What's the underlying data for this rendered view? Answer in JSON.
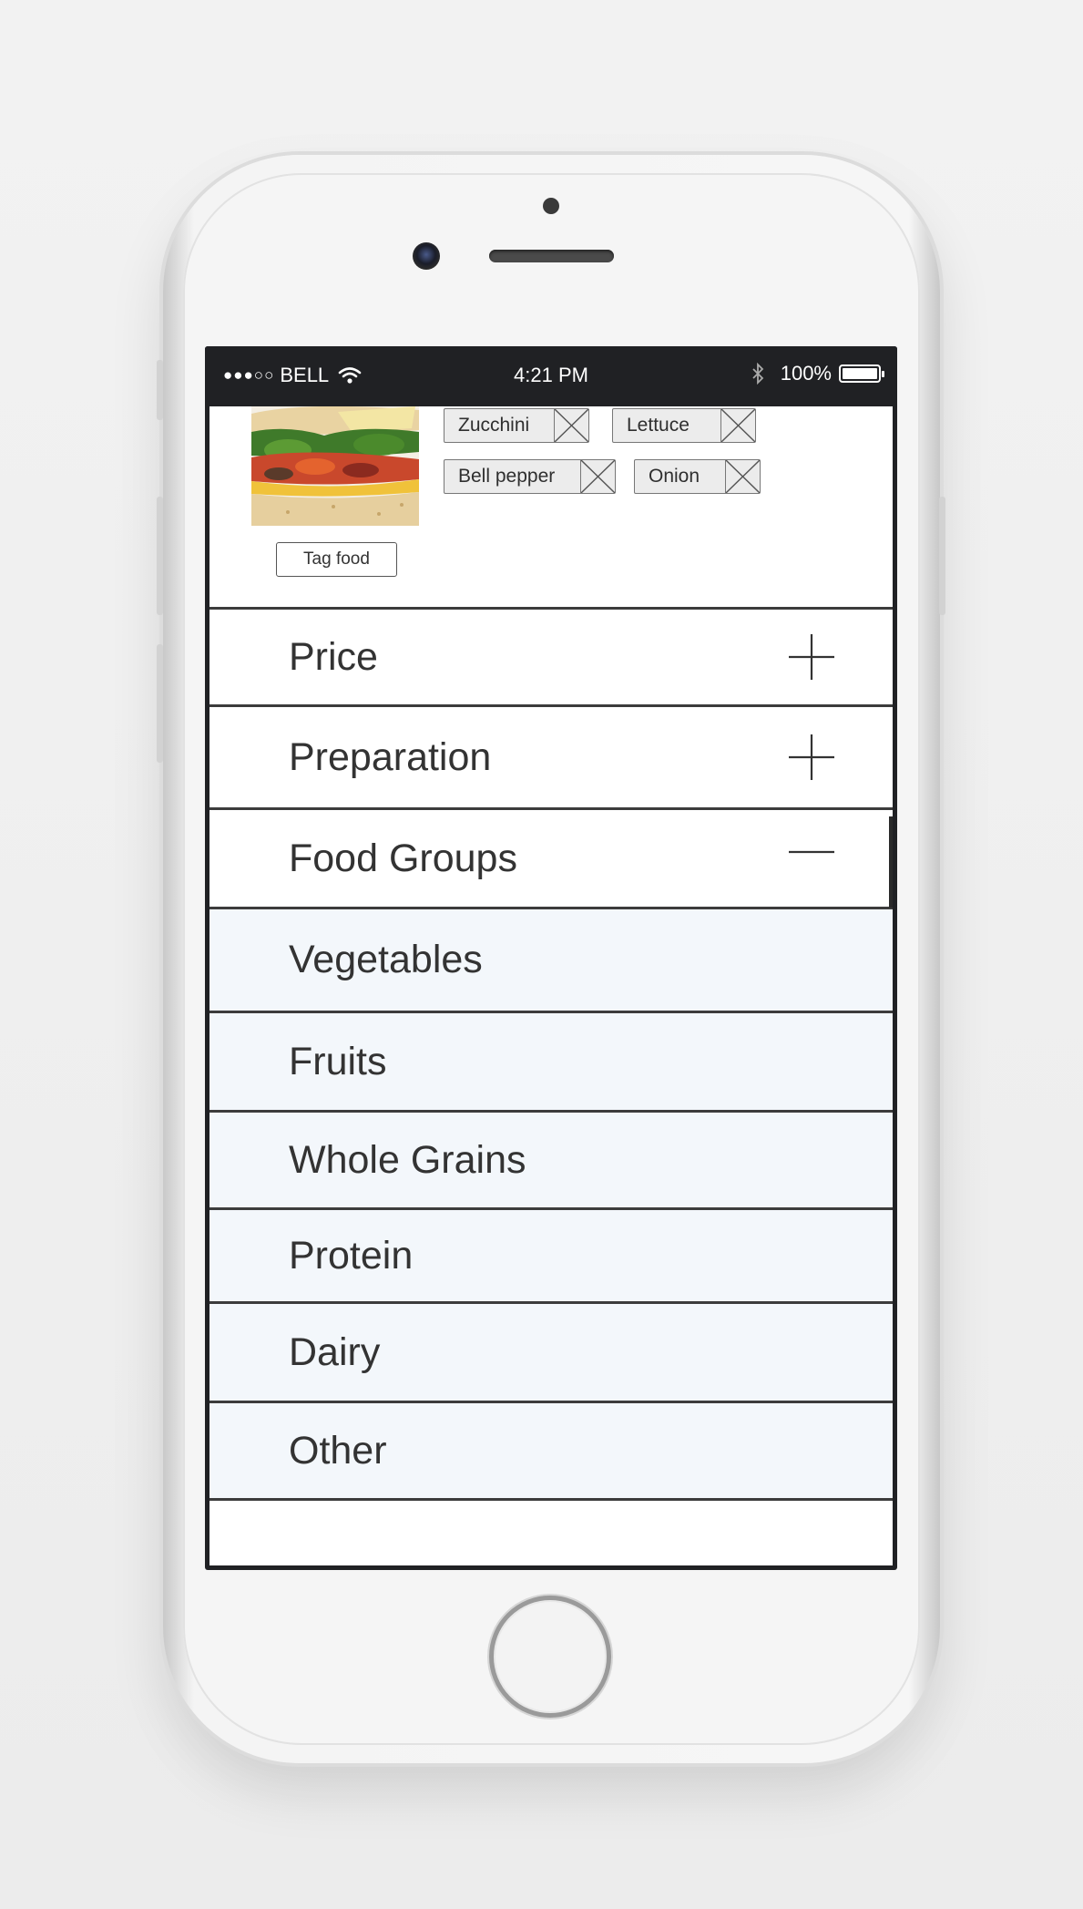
{
  "status_bar": {
    "signal": "●●●○○",
    "carrier": "BELL",
    "time": "4:21 PM",
    "battery": "100%"
  },
  "food": {
    "tags": [
      "Zucchini",
      "Lettuce",
      "Bell pepper",
      "Onion"
    ],
    "tag_button_label": "Tag food"
  },
  "sections": [
    {
      "label": "Price",
      "toggle": "+"
    },
    {
      "label": "Preparation",
      "toggle": "+"
    },
    {
      "label": "Food Groups",
      "toggle": "−"
    }
  ],
  "food_groups": [
    "Vegetables",
    "Fruits",
    "Whole Grains",
    "Protein",
    "Dairy",
    "Other"
  ]
}
